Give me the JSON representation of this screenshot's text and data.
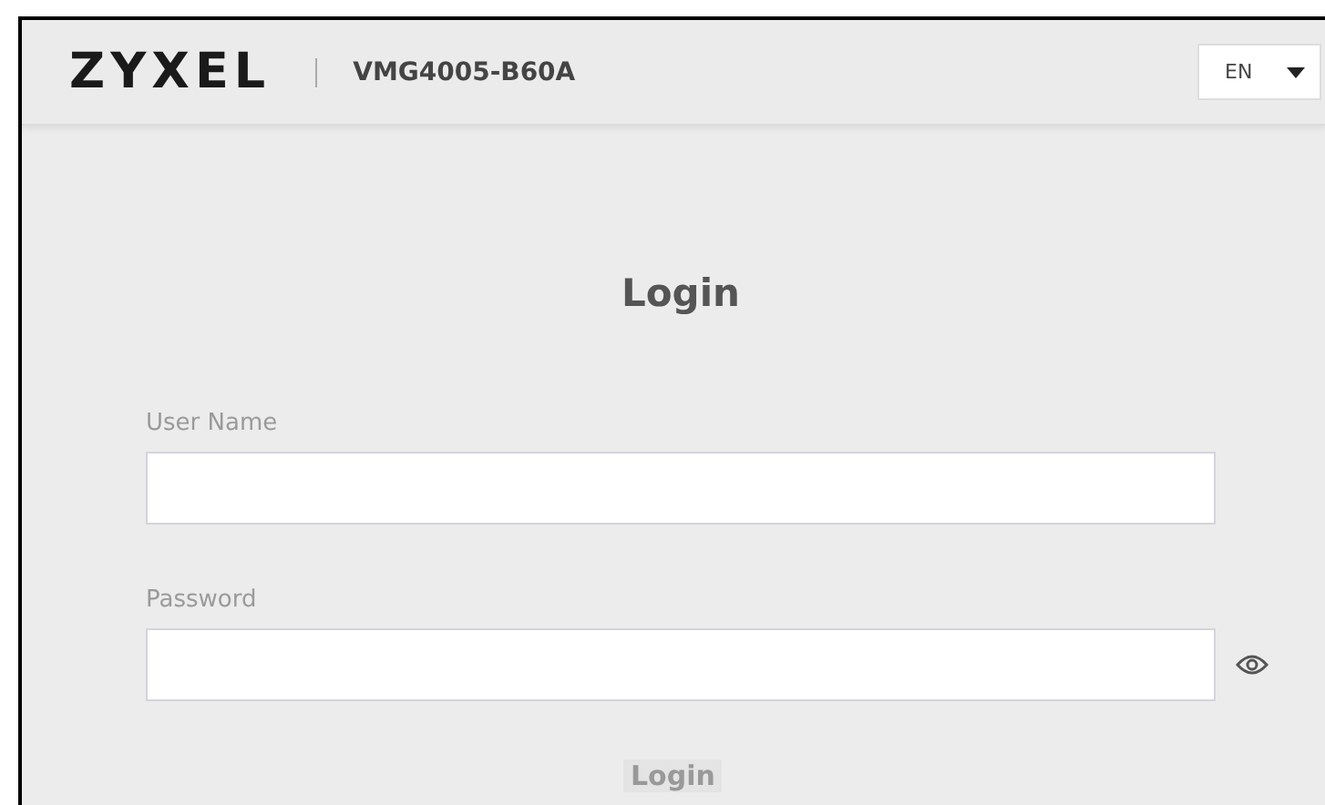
{
  "header": {
    "logo": "ZYXEL",
    "model": "VMG4005-B60A",
    "language": "EN"
  },
  "form": {
    "title": "Login",
    "fields": [
      {
        "label": "User Name",
        "reveal_toggle": false
      },
      {
        "label": "Password",
        "reveal_toggle": true
      }
    ],
    "submit": "Login"
  }
}
